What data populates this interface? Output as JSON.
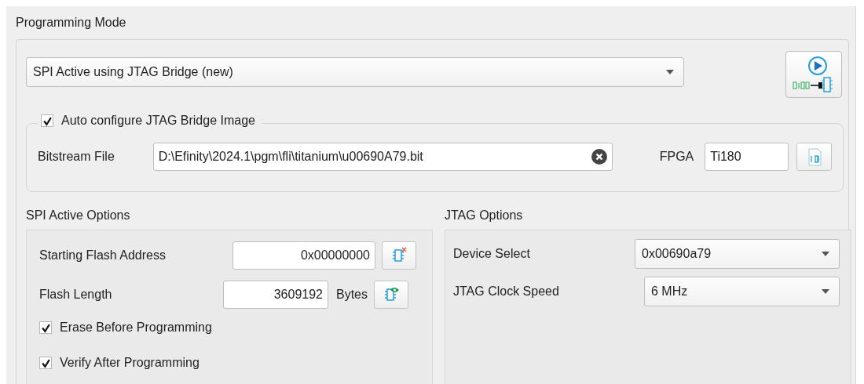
{
  "title": "Programming Mode",
  "mode_select": {
    "value": "SPI Active using JTAG Bridge (new)"
  },
  "auto_configure": {
    "label": "Auto configure JTAG Bridge Image",
    "checked": true,
    "bitstream": {
      "label": "Bitstream File",
      "value": "D:\\Efinity\\2024.1\\pgm\\fli\\titanium\\u00690A79.bit"
    },
    "fpga": {
      "label": "FPGA",
      "value": "Ti180"
    }
  },
  "spi_options": {
    "title": "SPI Active Options",
    "start_address": {
      "label": "Starting Flash Address",
      "value": "0x00000000"
    },
    "flash_length": {
      "label": "Flash Length",
      "value": "3609192",
      "unit": "Bytes"
    },
    "checkboxes": [
      {
        "label": "Erase Before Programming",
        "checked": true
      },
      {
        "label": "Verify After Programming",
        "checked": true
      }
    ]
  },
  "jtag_options": {
    "title": "JTAG Options",
    "rows": [
      {
        "label": "Device Select",
        "value": "0x00690a79"
      },
      {
        "label": "JTAG Clock Speed",
        "value": "6 MHz"
      }
    ]
  }
}
